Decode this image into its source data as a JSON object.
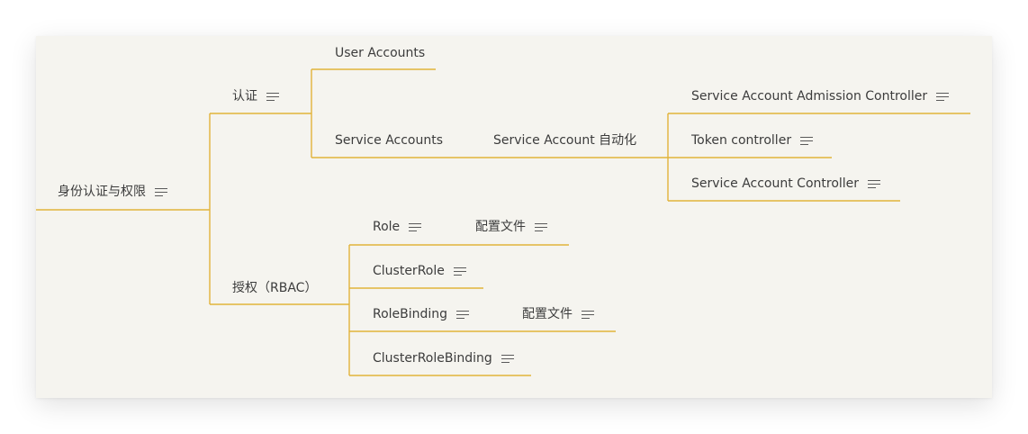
{
  "colors": {
    "branch": "#e2b33a",
    "canvas": "#f5f4ef",
    "text": "#3c3c3c"
  },
  "nodes": {
    "root": "身份认证与权限",
    "auth": "认证",
    "user_accounts": "User Accounts",
    "service_accounts": "Service Accounts",
    "sa_automation": "Service Account 自动化",
    "sa_admission": "Service Account Admission Controller",
    "token_controller": "Token controller",
    "sa_controller": "Service Account Controller",
    "rbac": "授权（RBAC）",
    "role": "Role",
    "role_config": "配置文件",
    "clusterrole": "ClusterRole",
    "rolebinding": "RoleBinding",
    "rolebinding_config": "配置文件",
    "clusterrolebinding": "ClusterRoleBinding"
  },
  "icons": {
    "note": "note-lines-icon"
  }
}
